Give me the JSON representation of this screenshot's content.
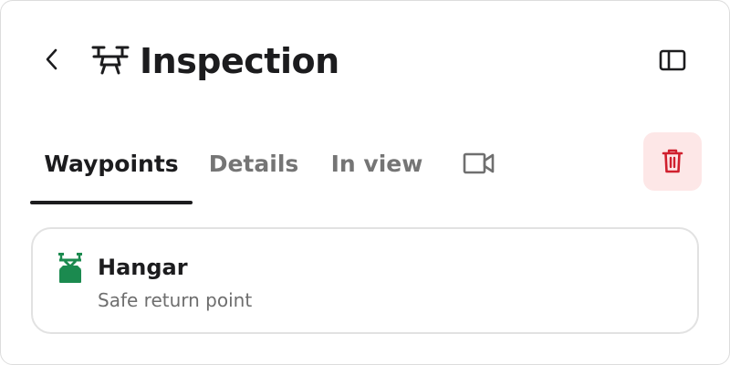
{
  "header": {
    "title": "Inspection",
    "back_icon": "chevron-left-icon",
    "title_icon": "drone-icon",
    "panel_toggle_icon": "sidebar-panel-icon"
  },
  "tabs": [
    {
      "label": "Waypoints",
      "active": true
    },
    {
      "label": "Details",
      "active": false
    },
    {
      "label": "In view",
      "active": false
    },
    {
      "icon": "video-camera-icon",
      "active": false
    }
  ],
  "delete_button": {
    "icon": "trash-icon",
    "color": "#d0202e",
    "background": "#fde7e7"
  },
  "waypoints": [
    {
      "name": "Hangar",
      "description": "Safe return point",
      "icon": "drone-hangar-icon",
      "icon_color": "#1b8a4f"
    }
  ]
}
